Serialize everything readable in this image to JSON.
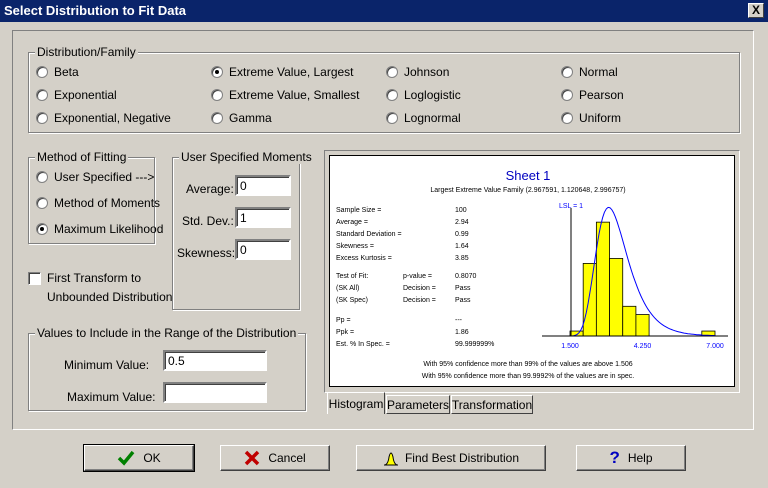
{
  "window": {
    "title": "Select Distribution to Fit Data",
    "close": "X"
  },
  "distribution_family": {
    "title": "Distribution/Family",
    "options": [
      {
        "label": "Beta",
        "selected": false
      },
      {
        "label": "Exponential",
        "selected": false
      },
      {
        "label": "Exponential, Negative",
        "selected": false
      },
      {
        "label": "Extreme Value, Largest",
        "selected": true
      },
      {
        "label": "Extreme Value, Smallest",
        "selected": false
      },
      {
        "label": "Gamma",
        "selected": false
      },
      {
        "label": "Johnson",
        "selected": false
      },
      {
        "label": "Loglogistic",
        "selected": false
      },
      {
        "label": "Lognormal",
        "selected": false
      },
      {
        "label": "Normal",
        "selected": false
      },
      {
        "label": "Pearson",
        "selected": false
      },
      {
        "label": "Uniform",
        "selected": false
      }
    ]
  },
  "method": {
    "title": "Method of Fitting",
    "options": [
      {
        "label": "User Specified --->",
        "selected": false
      },
      {
        "label": "Method of Moments",
        "selected": false
      },
      {
        "label": "Maximum Likelihood",
        "selected": true
      }
    ]
  },
  "moments": {
    "title": "User Specified Moments",
    "average_label": "Average:",
    "average_value": "0",
    "std_label": "Std. Dev.:",
    "std_value": "1",
    "skew_label": "Skewness:",
    "skew_value": "0"
  },
  "transform": {
    "line1": "First Transform to",
    "line2": "Unbounded Distribution",
    "checked": false
  },
  "range": {
    "title": "Values to Include in the Range of the Distribution",
    "min_label": "Minimum Value:",
    "min_value": "0.5",
    "max_label": "Maximum Value:",
    "max_value": ""
  },
  "report": {
    "title": "Sheet 1",
    "subtitle": "Largest Extreme Value Family (2.967591, 1.120648, 2.996757)",
    "stats": [
      {
        "label": "Sample Size =",
        "value": "100"
      },
      {
        "label": "Average =",
        "value": "2.94"
      },
      {
        "label": "Standard Deviation =",
        "value": "0.99"
      },
      {
        "label": "Skewness =",
        "value": "1.64"
      },
      {
        "label": "Excess Kurtosis =",
        "value": "3.85"
      }
    ],
    "fit": [
      {
        "label": "Test of Fit:",
        "mid": "p-value =",
        "value": "0.8070"
      },
      {
        "label": "(SK All)",
        "mid": "Decision =",
        "value": "Pass"
      },
      {
        "label": "(SK Spec)",
        "mid": "Decision =",
        "value": "Pass"
      }
    ],
    "cap": [
      {
        "label": "Pp =",
        "value": "---"
      },
      {
        "label": "Ppk =",
        "value": "1.86"
      },
      {
        "label": "Est. % In Spec. =",
        "value": "99.999999%"
      }
    ],
    "conf1": "With 95% confidence more than 99% of the values are above 1.506",
    "conf2": "With 95% confidence more than 99.9992% of the values are in spec.",
    "lsl_label": "LSL = 1"
  },
  "chart_data": {
    "type": "bar",
    "x_ticks": [
      "1.500",
      "4.250",
      "7.000"
    ],
    "xlim": [
      1.5,
      7.0
    ],
    "lsl": 1,
    "bins": [
      {
        "x0": 1.5,
        "x1": 2.0,
        "h": 0.03
      },
      {
        "x0": 2.0,
        "x1": 2.5,
        "h": 0.44
      },
      {
        "x0": 2.5,
        "x1": 3.0,
        "h": 0.69
      },
      {
        "x0": 3.0,
        "x1": 3.5,
        "h": 0.47
      },
      {
        "x0": 3.5,
        "x1": 4.0,
        "h": 0.18
      },
      {
        "x0": 4.0,
        "x1": 4.5,
        "h": 0.13
      },
      {
        "x0": 6.5,
        "x1": 7.0,
        "h": 0.03
      }
    ]
  },
  "tabs": [
    "Histogram",
    "Parameters",
    "Transformation"
  ],
  "buttons": {
    "ok": "OK",
    "cancel": "Cancel",
    "find": "Find Best Distribution",
    "help": "Help"
  },
  "colors": {
    "title_bar": "#0a246a",
    "bars": "#ffff00",
    "curve": "#0000ff",
    "title_text": "#0000c0"
  }
}
